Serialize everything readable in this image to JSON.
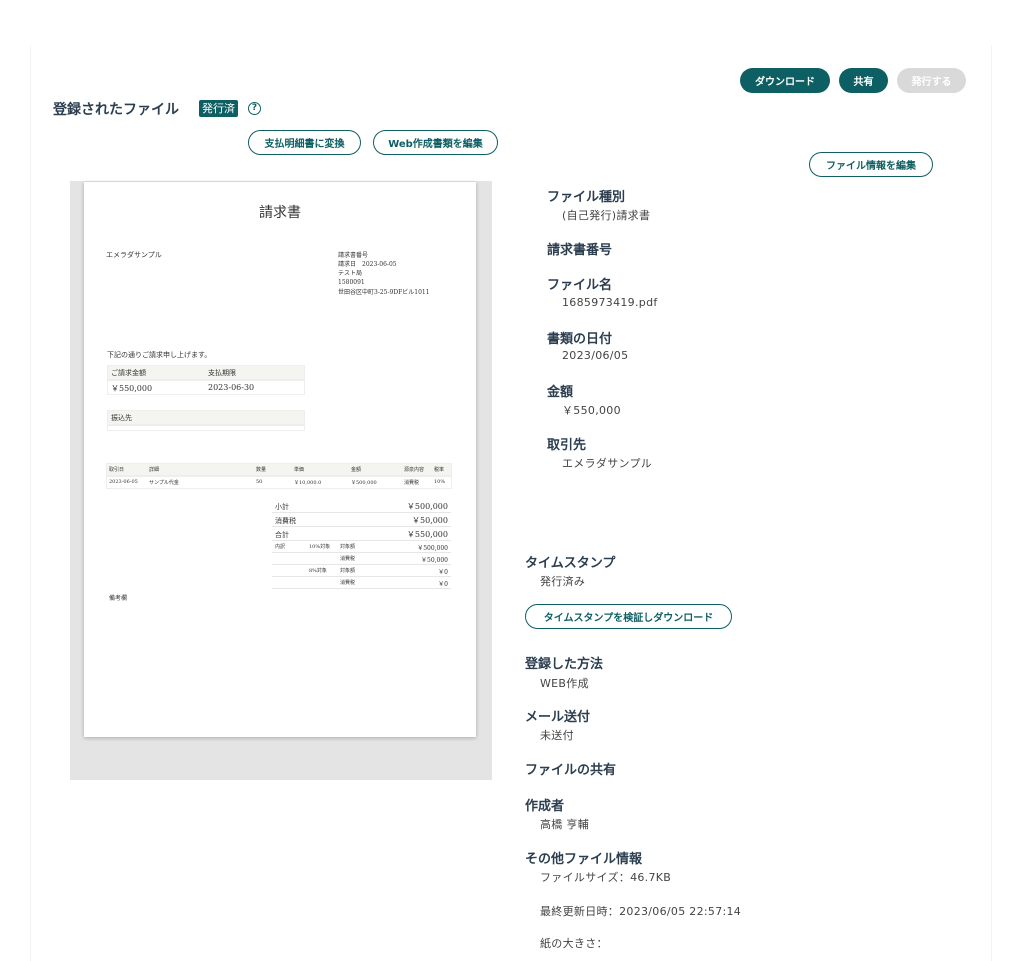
{
  "header": {
    "title": "登録されたファイル",
    "status_badge": "発行済",
    "help_glyph": "?"
  },
  "toolbar": {
    "download_label": "ダウンロード",
    "share_label": "共有",
    "issue_label": "発行する"
  },
  "actions": {
    "convert_label": "支払明細書に変換",
    "edit_web_label": "Web作成書類を編集",
    "edit_info_label": "ファイル情報を編集",
    "verify_ts_label": "タイムスタンプを検証しダウンロード"
  },
  "document": {
    "title": "請求書",
    "recipient": "エメラダサンプル",
    "issuer_lines": [
      "請求書番号",
      "請求日　2023-06-05",
      "テスト局",
      "1580091",
      "世田谷区中町3-25-9DFビル1011"
    ],
    "greeting": "下記の通りご請求申し上げます。",
    "amount_header": "ご請求金額",
    "due_header": "支払期限",
    "amount_value": "￥550,000",
    "due_value": "2023-06-30",
    "bank_header": "振込先",
    "items_headers": [
      "取引日",
      "詳細",
      "数量",
      "単価",
      "金額",
      "源泉内容",
      "税率"
    ],
    "items_rows": [
      [
        "2023-06-05",
        "サンプル代金",
        "50",
        "￥10,000.0",
        "￥500,000",
        "消費税",
        "10%"
      ]
    ],
    "subtotal_label": "小計",
    "subtotal_value": "￥500,000",
    "tax_label": "消費税",
    "tax_value": "￥50,000",
    "total_label": "合計",
    "total_value": "￥550,000",
    "breakdown_label": "内訳",
    "rate10_label": "10%対象",
    "rate8_label": "8%対象",
    "target_label": "対象額",
    "tax_small_label": "消費税",
    "r10_target": "￥500,000",
    "r10_tax": "￥50,000",
    "r8_target": "￥0",
    "r8_tax": "￥0",
    "remarks_label": "備考欄"
  },
  "info": {
    "file_type_label": "ファイル種別",
    "file_type_value": "(自己発行)請求書",
    "invoice_no_label": "請求書番号",
    "file_name_label": "ファイル名",
    "file_name_value": "1685973419.pdf",
    "doc_date_label": "書類の日付",
    "doc_date_value": "2023/06/05",
    "amount_label": "金額",
    "amount_value": "￥550,000",
    "partner_label": "取引先",
    "partner_value": "エメラダサンプル",
    "timestamp_label": "タイムスタンプ",
    "timestamp_value": "発行済み",
    "method_label": "登録した方法",
    "method_value": "WEB作成",
    "mail_label": "メール送付",
    "mail_value": "未送付",
    "sharing_label": "ファイルの共有",
    "creator_label": "作成者",
    "creator_value": "高橋 亨輔",
    "other_label": "その他ファイル情報",
    "file_size": "ファイルサイズ：46.7KB",
    "last_modified": "最終更新日時：2023/06/05 22:57:14",
    "paper_size": "紙の大きさ："
  }
}
